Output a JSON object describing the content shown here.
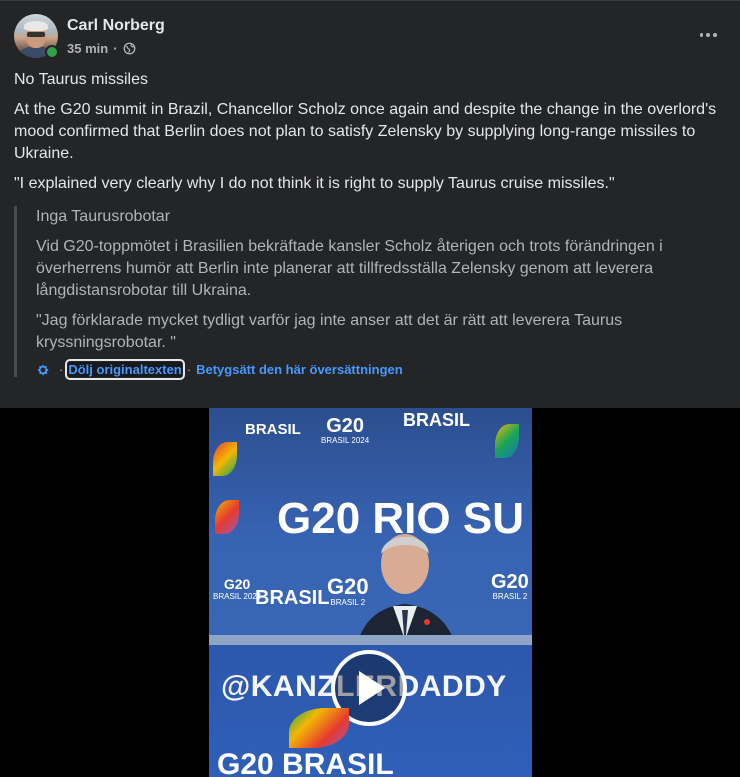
{
  "post": {
    "author": "Carl Norberg",
    "time": "35 min",
    "separator": "·",
    "privacy_icon": "globe-icon",
    "more_icon": "more-horizontal-icon",
    "paragraphs": [
      "No Taurus missiles",
      "At the G20 summit in Brazil, Chancellor Scholz once again and despite the change in the overlord's mood confirmed that Berlin does not plan to satisfy Zelensky by supplying long-range missiles to Ukraine.",
      "\"I explained very clearly why I do not think it is right to supply Taurus cruise missiles.\""
    ],
    "original": {
      "paragraphs": [
        "Inga Taurusrobotar",
        "Vid G20-toppmötet i Brasilien bekräftade kansler Scholz återigen och trots förändringen i överherrens humör att Berlin inte planerar att tillfredsställa Zelensky genom att leverera långdistansrobotar till Ukraina.",
        "\"Jag förklarade mycket tydligt varför jag inte anser att det är rätt att leverera Taurus kryssningsrobotar. \""
      ],
      "translation_settings_icon": "gear-icon",
      "hide_original_label": "Dölj originaltexten",
      "rate_translation_label": "Betygsätt den här översättningen",
      "separator": "·"
    }
  },
  "video": {
    "backdrop_text": "G20 RIO SU",
    "logo_top_left": "BRASIL",
    "logo_top_center_1": "G20",
    "logo_top_center_2": "BRASIL 2024",
    "logo_top_right": "BRASIL",
    "logo_mid_left_1": "G20",
    "logo_mid_left_2": "BRASIL 2024",
    "logo_mid_center": "BRASIL",
    "logo_mid_right_1": "G20",
    "logo_mid_right_2": "BRASIL 2",
    "logo_far_right_1": "G20",
    "logo_far_right_2": "BRASIL 2",
    "watermark": "@KANZLERDADDY",
    "bottom_logo": "G20  BRASIL",
    "play_icon": "play-icon",
    "accent_colors": [
      "#e63b2e",
      "#f2b705",
      "#18a558",
      "#1e73be",
      "#9b59b6"
    ]
  },
  "colors": {
    "card_bg": "#242526",
    "link": "#4599ff",
    "secondary_text": "#b0b3b8",
    "primary_text": "#e4e6eb",
    "online": "#31a24c"
  }
}
